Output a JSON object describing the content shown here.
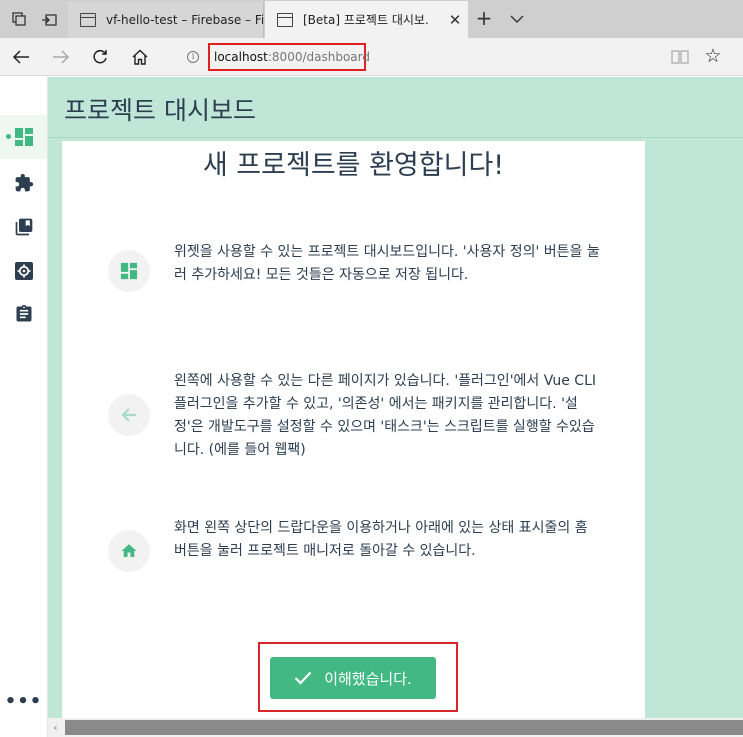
{
  "browser": {
    "tabs": [
      {
        "title": "vf-hello-test – Firebase – Fir",
        "active": false
      },
      {
        "title": "[Beta] 프로젝트 대시보.",
        "active": true
      }
    ],
    "close_glyph": "✕",
    "new_tab_glyph": "+",
    "url_host": "localhost",
    "url_path": ":8000/dashboard",
    "info_glyph": "i",
    "favorite_glyph": "☆"
  },
  "sidebar": {
    "items": [
      {
        "icon": "dashboard-icon",
        "active": true
      },
      {
        "icon": "plugins-icon",
        "active": false
      },
      {
        "icon": "dependencies-icon",
        "active": false
      },
      {
        "icon": "settings-icon",
        "active": false
      },
      {
        "icon": "tasks-icon",
        "active": false
      }
    ],
    "more_label": "•••"
  },
  "page": {
    "title": "프로젝트 대시보드",
    "welcome_heading": "새 프로젝트를 환영합니다!",
    "tips": [
      {
        "icon": "dashboard-icon",
        "text": "위젯을 사용할 수 있는 프로젝트 대시보드입니다. '사용자 정의' 버튼을 눌러 추가하세요! 모든 것들은 자동으로 저장 됩니다."
      },
      {
        "icon": "arrow-left-icon",
        "text": "왼쪽에 사용할 수 있는 다른 페이지가 있습니다. '플러그인'에서 Vue CLI 플러그인을 추가할 수 있고, '의존성' 에서는 패키지를 관리합니다. '설정'은 개발도구를 설정할 수 있으며 '태스크'는 스크립트를 실행할 수있습니다. (에를 들어 웹팩)"
      },
      {
        "icon": "home-icon",
        "text": "화면 왼쪽 상단의 드랍다운을 이용하거나 아래에 있는 상태 표시줄의 홈 버튼을 눌러 프로젝트 매니저로 돌아갈 수 있습니다."
      }
    ],
    "ok_button_label": "이해했습니다."
  },
  "colors": {
    "accent": "#42b983",
    "page_background": "#bfe6d7",
    "highlight_red": "#e01f1f",
    "text": "#2c3e50"
  }
}
